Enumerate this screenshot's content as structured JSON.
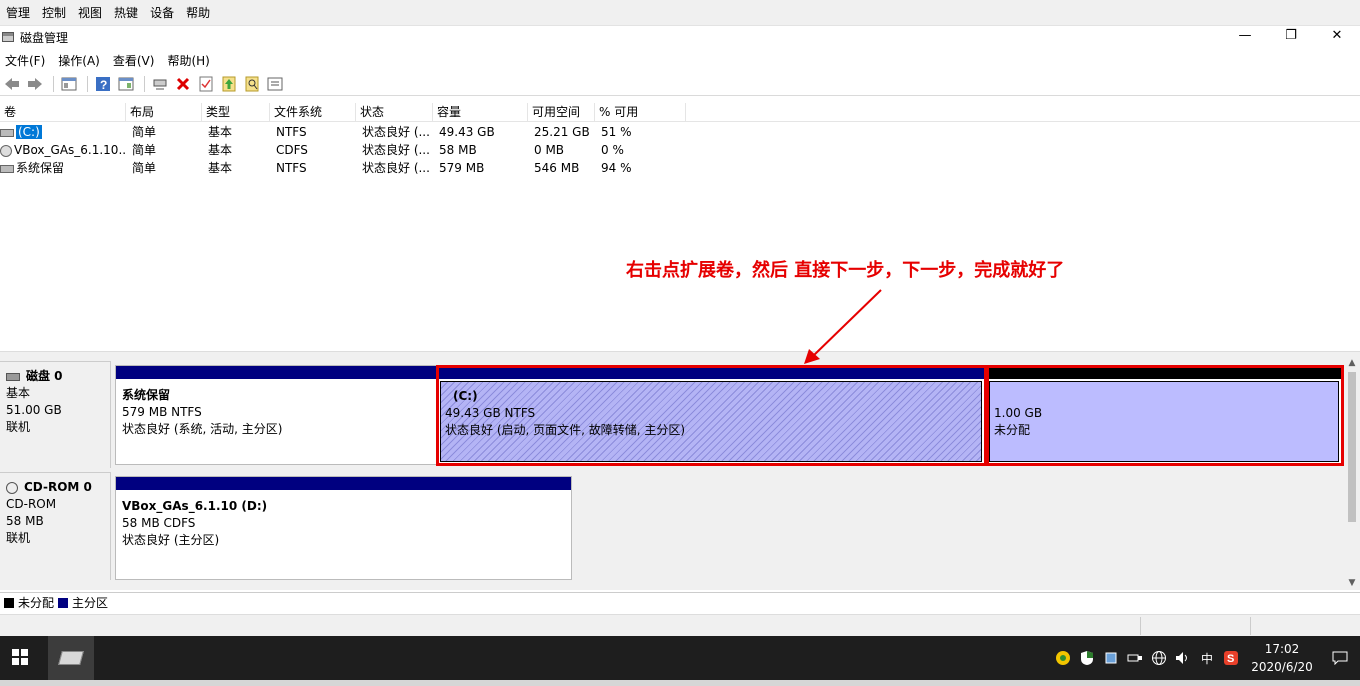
{
  "top_menu": [
    "管理",
    "控制",
    "视图",
    "热键",
    "设备",
    "帮助"
  ],
  "window": {
    "title": "磁盘管理",
    "minimize": "—",
    "restore": "❐",
    "close": "✕"
  },
  "menu": [
    "文件(F)",
    "操作(A)",
    "查看(V)",
    "帮助(H)"
  ],
  "toolbar": {
    "icons": [
      "back-icon",
      "forward-icon",
      "console-tree-icon",
      "help-icon",
      "properties-icon",
      "connect-disk-icon",
      "delete-icon",
      "check-icon",
      "import-icon",
      "search-icon",
      "rescan-icon"
    ]
  },
  "volume_table": {
    "columns": [
      "卷",
      "布局",
      "类型",
      "文件系统",
      "状态",
      "容量",
      "可用空间",
      "% 可用"
    ],
    "rows": [
      [
        "(C:)",
        "简单",
        "基本",
        "NTFS",
        "状态良好 (...",
        "49.43 GB",
        "25.21 GB",
        "51 %"
      ],
      [
        "VBox_GAs_6.1.10...",
        "简单",
        "基本",
        "CDFS",
        "状态良好 (...",
        "58 MB",
        "0 MB",
        "0 %"
      ],
      [
        "系统保留",
        "简单",
        "基本",
        "NTFS",
        "状态良好 (...",
        "579 MB",
        "546 MB",
        "94 %"
      ]
    ]
  },
  "annotation": "右击点扩展卷，然后 直接下一步，下一步，完成就好了",
  "disks": {
    "disk0": {
      "name": "磁盘 0",
      "type": "基本",
      "size": "51.00 GB",
      "status": "联机",
      "partitions": [
        {
          "name": "系统保留",
          "size": "579 MB NTFS",
          "status": "状态良好 (系统, 活动, 主分区)"
        },
        {
          "name": "(C:)",
          "size": "49.43 GB NTFS",
          "status": "状态良好 (启动, 页面文件, 故障转储, 主分区)"
        },
        {
          "size": "1.00 GB",
          "status": "未分配"
        }
      ]
    },
    "cdrom0": {
      "name": "CD-ROM 0",
      "type": "CD-ROM",
      "size": "58 MB",
      "status": "联机",
      "partitions": [
        {
          "name": "VBox_GAs_6.1.10  (D:)",
          "size": "58 MB CDFS",
          "status": "状态良好 (主分区)"
        }
      ]
    }
  },
  "legend": [
    {
      "label": "未分配",
      "color": "#000000"
    },
    {
      "label": "主分区",
      "color": "#000080"
    }
  ],
  "taskbar": {
    "tray_lang": "中",
    "time": "17:02",
    "date": "2020/6/20"
  }
}
